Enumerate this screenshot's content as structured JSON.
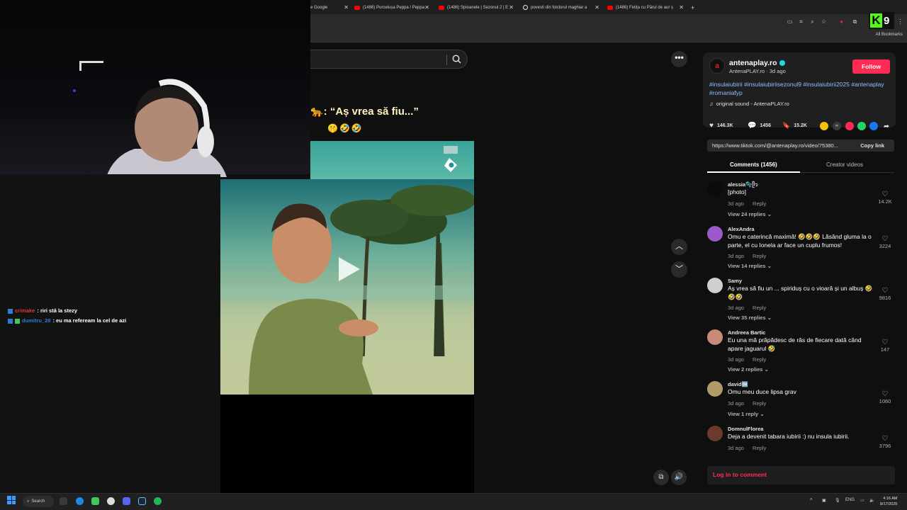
{
  "browser": {
    "tabs": [
      {
        "label": "e Google",
        "icon": "google-icon"
      },
      {
        "label": "(1486) Purcelușa Peppa / Peppa",
        "icon": "youtube-icon"
      },
      {
        "label": "(1486) Spioanele | Sezonul 2 | E",
        "icon": "youtube-icon"
      },
      {
        "label": "povesti din folclorul maghiar a",
        "icon": "globe-icon"
      },
      {
        "label": "(1486) Fetița cu Părul de aur ș",
        "icon": "youtube-icon"
      }
    ],
    "new_tab": "+",
    "bookmarks_label": "All Bookmarks"
  },
  "kick_badge": {
    "letter": "K",
    "number": "9"
  },
  "chat": [
    {
      "user": "crimake",
      "text": ": riri stă la stezy"
    },
    {
      "user": "dumitru_28",
      "text": ": eu ma refeream la cel de azi"
    }
  ],
  "tiktok": {
    "caption": "🐆: “Aș vrea să fiu...”",
    "emojis": "🤫🤣🤣",
    "account": {
      "handle": "antenaplay.ro",
      "sub": "AntenaPLAY.ro · 3d ago",
      "follow": "Follow"
    },
    "hashtags": "#insulaiubirii #insulaiubiriisezonul9 #insulaiubirii2025 #antenaplay #romaniafyp",
    "sound": "original sound - AntenaPLAY.ro",
    "stats": {
      "likes": "146.3K",
      "comments": "1456",
      "saves": "15.2K"
    },
    "link": "https://www.tiktok.com/@antenaplay.ro/video/75380...",
    "copy_link": "Copy link",
    "tab_comments": "Comments (1456)",
    "tab_creator": "Creator videos",
    "comments": [
      {
        "user": "alessia🫧ᥫ᭡",
        "text": "[photo]",
        "date": "3d ago",
        "reply": "Reply",
        "replies": "View 24 replies",
        "likes": "14.2K",
        "avatar_color": "#0b0b0b"
      },
      {
        "user": "AlexAndra",
        "text": "Omu e caterincă maximă! 🤣🤣🤣 Lăsând gluma la o parte, el cu Ionela ar face un cuplu frumos!",
        "date": "3d ago",
        "reply": "Reply",
        "replies": "View 14 replies",
        "likes": "3224",
        "avatar_color": "#9b59c9"
      },
      {
        "user": "Samy",
        "text": "Aș vrea să fiu un ... spiriduș cu o vioară și un albuș 🤣🤣🤣",
        "date": "3d ago",
        "reply": "Reply",
        "replies": "View 35 replies",
        "likes": "9816",
        "avatar_color": "#cfcfcf"
      },
      {
        "user": "Andreea Bartic",
        "text": "Eu una mă prăpădesc de râs de fiecare dată când apare jaguarul 🤣",
        "date": "3d ago",
        "reply": "Reply",
        "replies": "View 2 replies",
        "likes": "147",
        "avatar_color": "#c98a7a"
      },
      {
        "user": "david🆗",
        "text": "Omu meu duce lipsa grav",
        "date": "3d ago",
        "reply": "Reply",
        "replies": "View 1 reply",
        "likes": "1060",
        "avatar_color": "#b39a6a"
      },
      {
        "user": "DomnulFlorea",
        "text": "Deja a devenit tabara iubirii :) nu insula iubirii.",
        "date": "3d ago",
        "reply": "Reply",
        "replies": "",
        "likes": "3796",
        "avatar_color": "#6a3a2a"
      }
    ],
    "login": "Log in to comment"
  },
  "taskbar": {
    "search": "Search",
    "lang": "ENG",
    "time": "4:16 AM",
    "date": "8/17/2025"
  }
}
